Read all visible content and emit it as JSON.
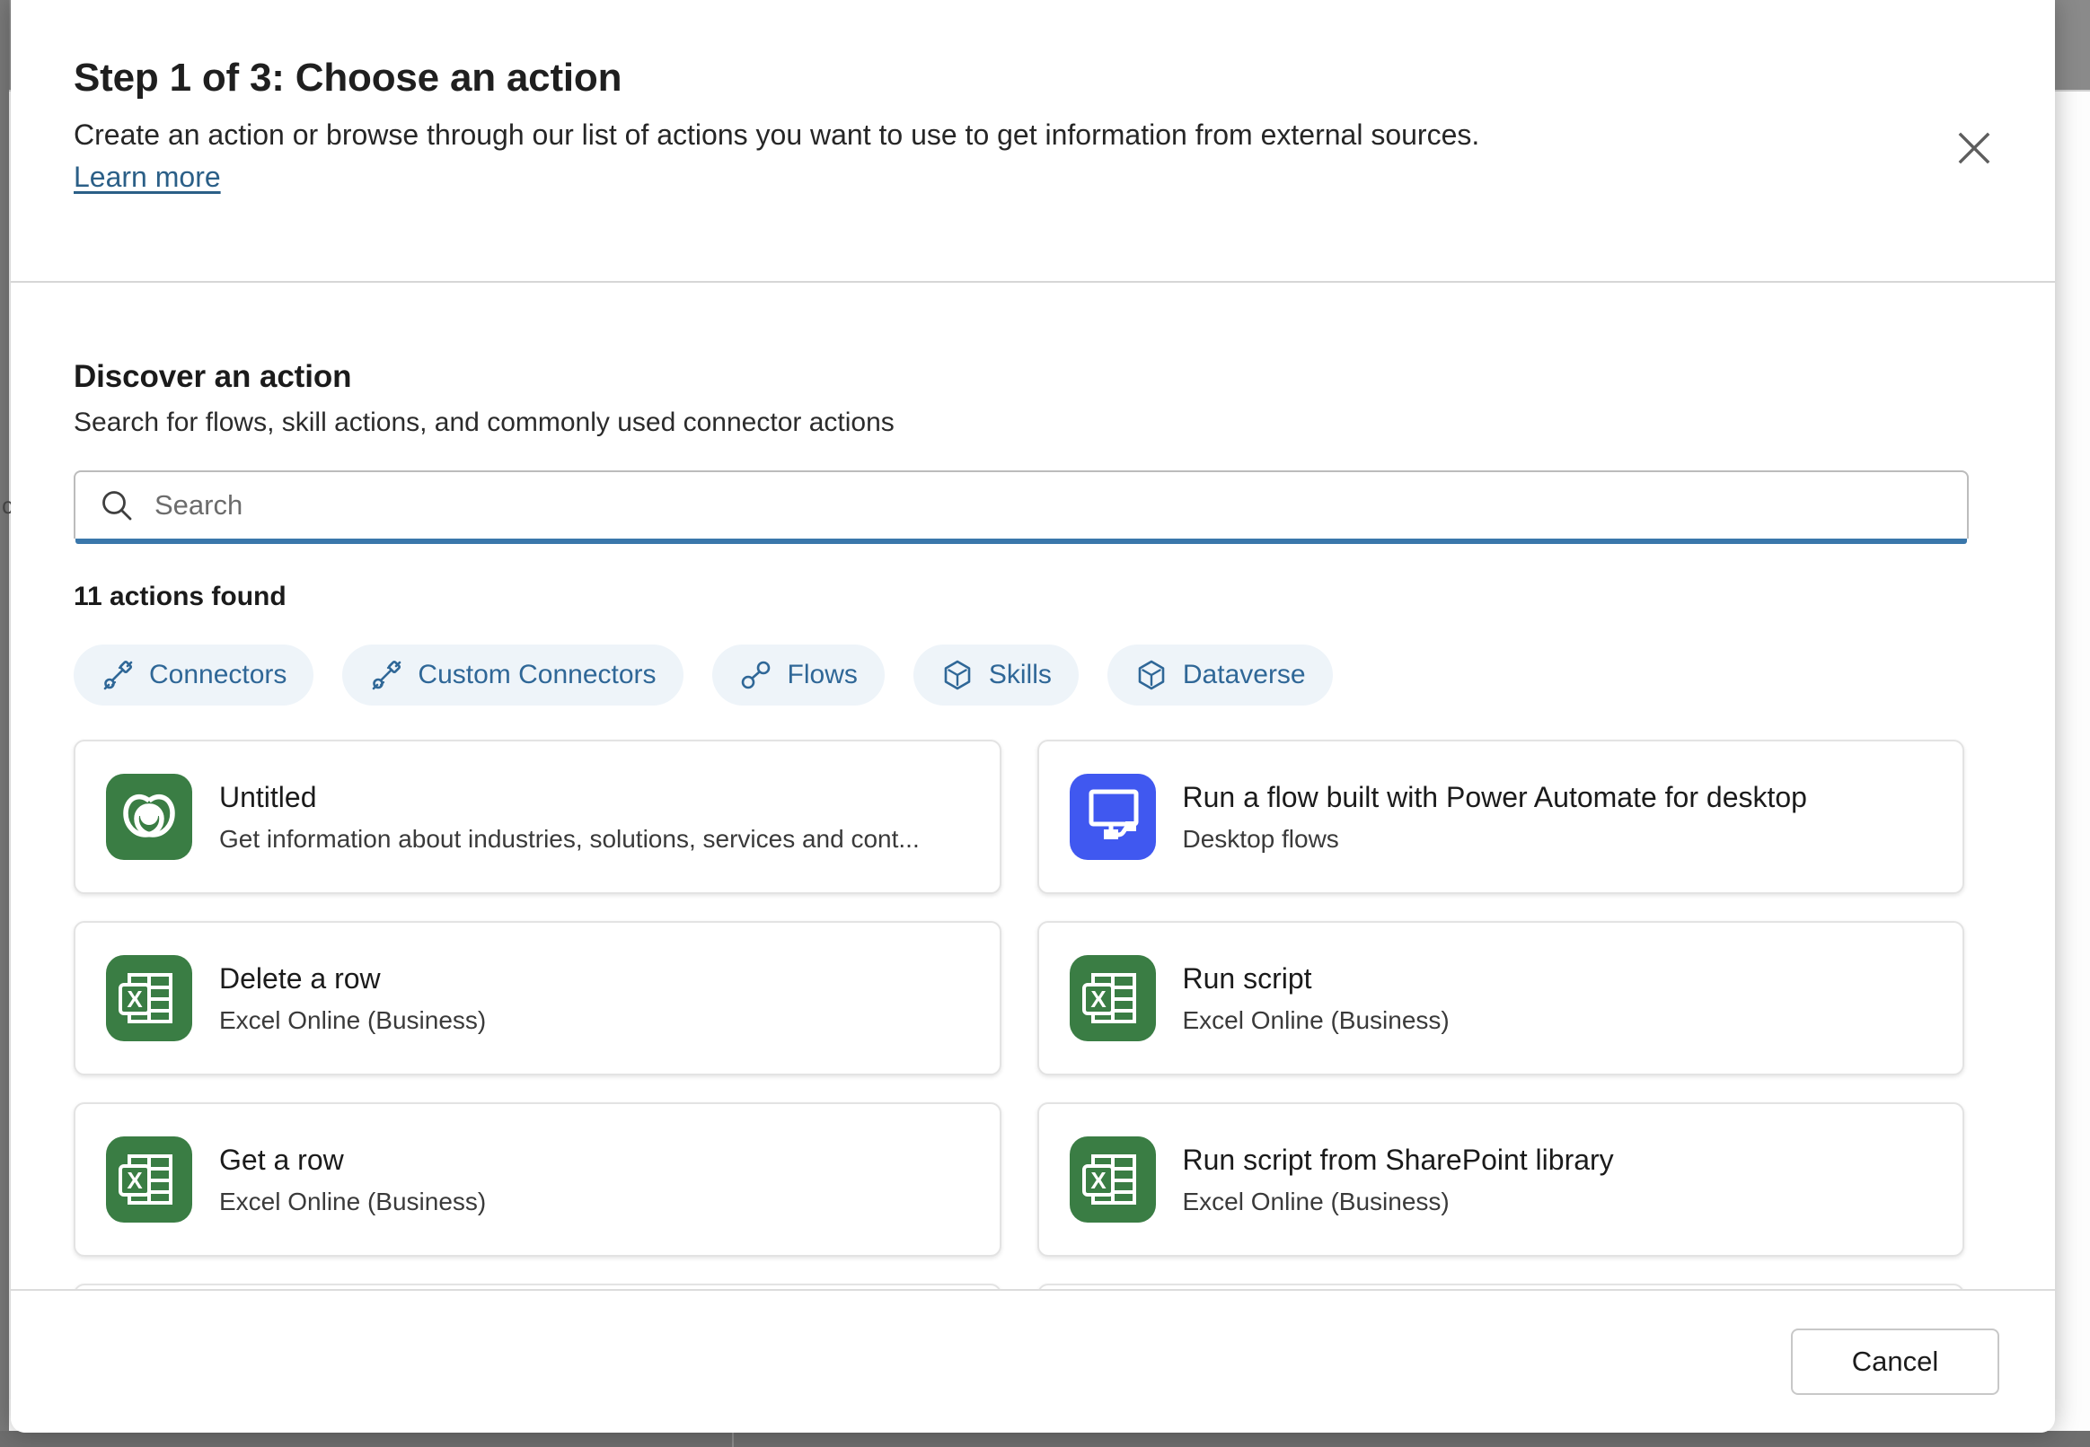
{
  "backdrop": {
    "partial_text": "c"
  },
  "dialog": {
    "title": "Step 1 of 3: Choose an action",
    "subtitle": "Create an action or browse through our list of actions you want to use to get information from external sources.",
    "learn_more_label": "Learn more",
    "close_icon": "close-icon"
  },
  "discover": {
    "heading": "Discover an action",
    "subheading": "Search for flows, skill actions, and commonly used connector actions",
    "search": {
      "placeholder": "Search",
      "value": "",
      "icon": "search-icon",
      "focused": true,
      "accent_color": "#3a77ab"
    },
    "results_count": "11 actions found"
  },
  "filters": [
    {
      "label": "Connectors",
      "icon": "connector-plug-icon"
    },
    {
      "label": "Custom Connectors",
      "icon": "connector-plug-icon"
    },
    {
      "label": "Flows",
      "icon": "flow-nodes-icon"
    },
    {
      "label": "Skills",
      "icon": "cube-icon"
    },
    {
      "label": "Dataverse",
      "icon": "cube-icon"
    }
  ],
  "cards": [
    {
      "title": "Untitled",
      "subtitle": "Get information about industries, solutions, services and cont...",
      "icon": "swirl-logo-icon",
      "icon_color": "#3a7d44"
    },
    {
      "title": "Run a flow built with Power Automate for desktop",
      "subtitle": "Desktop flows",
      "icon": "desktop-flow-icon",
      "icon_color": "#4058f0"
    },
    {
      "title": "Delete a row",
      "subtitle": "Excel Online (Business)",
      "icon": "excel-icon",
      "icon_color": "#3a7d44"
    },
    {
      "title": "Run script",
      "subtitle": "Excel Online (Business)",
      "icon": "excel-icon",
      "icon_color": "#3a7d44"
    },
    {
      "title": "Get a row",
      "subtitle": "Excel Online (Business)",
      "icon": "excel-icon",
      "icon_color": "#3a7d44"
    },
    {
      "title": "Run script from SharePoint library",
      "subtitle": "Excel Online (Business)",
      "icon": "excel-icon",
      "icon_color": "#3a7d44"
    }
  ],
  "footer": {
    "cancel_label": "Cancel"
  },
  "colors": {
    "chip_background": "#eef4f9",
    "chip_text": "#2f6797",
    "link": "#2b5f87",
    "excel_green": "#3a7d44",
    "power_automate_blue": "#4058f0"
  }
}
